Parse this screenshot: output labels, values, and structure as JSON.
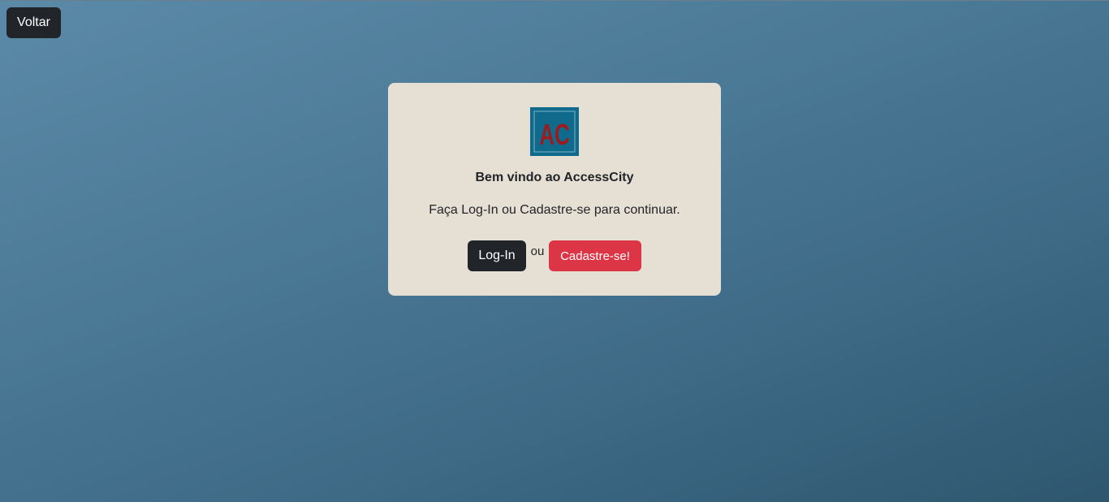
{
  "nav": {
    "back_label": "Voltar"
  },
  "card": {
    "logo": {
      "icon": "accesscity-logo",
      "text": "AC",
      "bg_color": "#0f6a8b",
      "text_color": "#9b1b1f"
    },
    "title": "Bem vindo ao AccessCity",
    "subtitle": "Faça Log-In ou Cadastre-se para continuar.",
    "login_label": "Log-In",
    "or_label": "ou",
    "signup_label": "Cadastre-se!"
  },
  "colors": {
    "card_bg": "#e6dfd3",
    "dark_button": "#212529",
    "danger_button": "#dc3545"
  }
}
